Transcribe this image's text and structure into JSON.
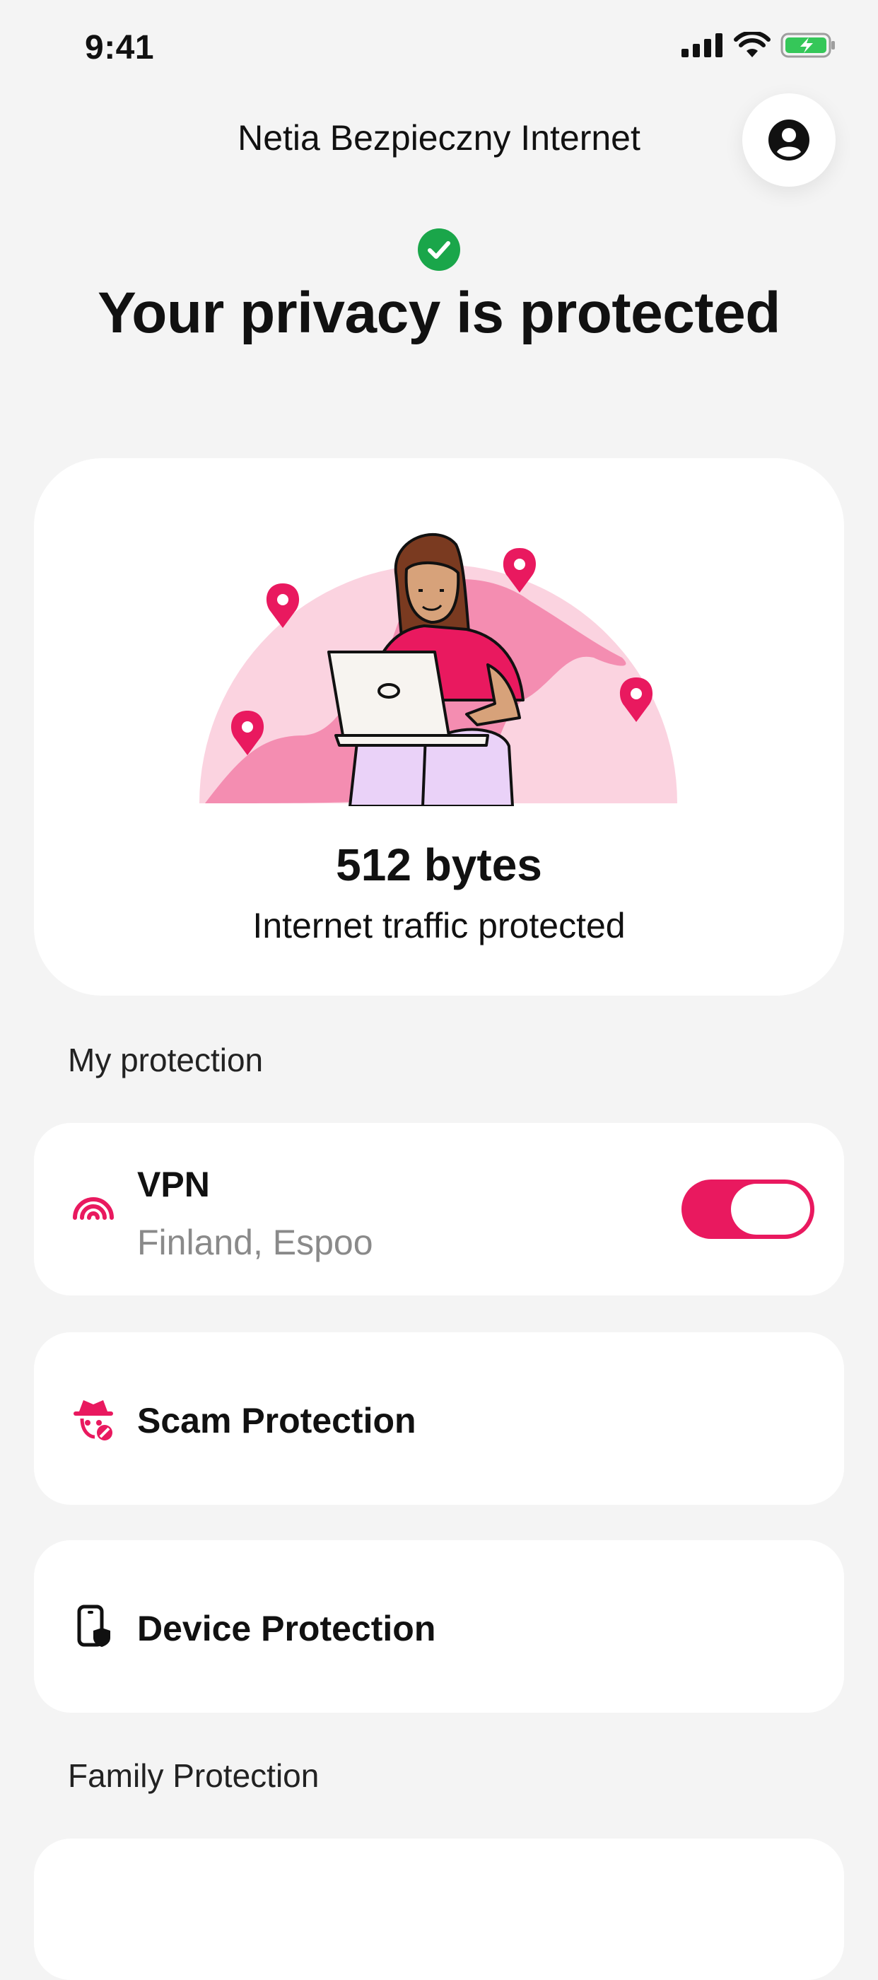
{
  "status_bar": {
    "time": "9:41",
    "icons": [
      "signal-icon",
      "wifi-icon",
      "battery-charging-icon"
    ]
  },
  "header": {
    "title": "Netia Bezpieczny Internet",
    "profile_icon": "account-circle-icon"
  },
  "status": {
    "icon": "check-circle-icon",
    "headline": "Your privacy is protected"
  },
  "hero": {
    "illustration": "person-with-laptop-map-pins",
    "traffic_amount": "512 bytes",
    "traffic_label": "Internet traffic protected"
  },
  "my_protection": {
    "title": "My protection",
    "items": [
      {
        "title": "VPN",
        "subtitle": "Finland, Espoo",
        "icon": "vpn-signal-icon",
        "toggle": true
      },
      {
        "title": "Scam Protection",
        "icon": "scam-spy-icon"
      },
      {
        "title": "Device Protection",
        "icon": "device-shield-icon"
      }
    ]
  },
  "family_protection": {
    "title": "Family Protection"
  },
  "colors": {
    "accent": "#e9195f",
    "success": "#1aa64a",
    "background": "#f4f4f4",
    "card": "#ffffff"
  }
}
